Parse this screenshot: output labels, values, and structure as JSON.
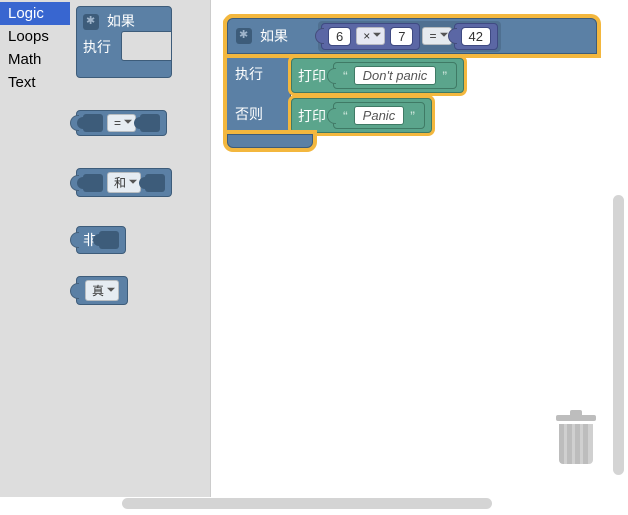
{
  "categories": {
    "items": [
      {
        "label": "Logic",
        "selected": true
      },
      {
        "label": "Loops",
        "selected": false
      },
      {
        "label": "Math",
        "selected": false
      },
      {
        "label": "Text",
        "selected": false
      }
    ]
  },
  "toolbox": {
    "if_label": "如果",
    "do_label": "执行",
    "compare_op": "=",
    "logic_op": "和",
    "not_label": "非",
    "bool_true": "真"
  },
  "workspace": {
    "if_block": {
      "if_label": "如果",
      "do_label": "执行",
      "else_label": "否则",
      "condition": {
        "left": {
          "a": "6",
          "op": "×",
          "b": "7"
        },
        "cmp": "=",
        "right": "42"
      },
      "do_stmt": {
        "print_label": "打印",
        "text": "Don't panic"
      },
      "else_stmt": {
        "print_label": "打印",
        "text": "Panic"
      }
    }
  },
  "icons": {
    "gear": "gear-icon",
    "trash": "trash-icon"
  }
}
